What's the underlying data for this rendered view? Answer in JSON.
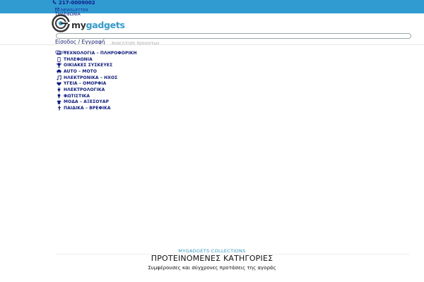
{
  "header": {
    "phone": "217-0009002",
    "newsletter_label": "NEWSLETTER",
    "phone_menu_label": "ΤΗΛΕΦΩΝΙΑ",
    "logo_text_prefix": "my",
    "logo_text_suffix": "gadgets"
  },
  "search": {
    "placeholder": "Αναζήτηση προϊόντων"
  },
  "account": {
    "login_label": "Είσοδος / Εγγραφή"
  },
  "menu": {
    "trigger_label": "Close"
  },
  "categories": [
    {
      "label": "ΤΕΧΝΟΛΟΓΙΑ – ΠΛΗΡΟΦΟΡΙΚΗ",
      "icon": "laptop-icon"
    },
    {
      "label": "ΤΗΛΕΦΩΝΙΑ",
      "icon": ""
    },
    {
      "label": "ΟΙΚΙΑΚΕΣ ΣΥΣΚΕΥΕΣ",
      "icon": "trophy-icon"
    },
    {
      "label": "AUTO – MOTO",
      "icon": "car-icon"
    },
    {
      "label": "ΗΛΕΚΤΡΟΝΙΚΑ – ΗΧΟΣ",
      "icon": "music-note-icon"
    },
    {
      "label": "ΥΓΕΙΑ – ΟΜΟΡΦΙΑ",
      "icon": "heart-icon"
    },
    {
      "label": "ΗΛΕΚΤΡΟΛΟΓΙΚΑ",
      "icon": "plug-icon"
    },
    {
      "label": "ΦΩΤΙΣΤΙΚΑ",
      "icon": "lightbulb-icon"
    },
    {
      "label": "ΜΟΔΑ – ΑΞΕΣΟΥΑΡ",
      "icon": "tshirt-icon"
    },
    {
      "label": "ΠΑΙΔΙΚΑ – ΒΡΕΦΙΚΑ",
      "icon": "child-icon"
    }
  ],
  "featured": {
    "eyebrow": "MYGADGETS COLLECTIONS",
    "title": "ΠΡΟΤΕΙΝΟΜΕΝΕΣ ΚΑΤΗΓΟΡΙΕΣ",
    "subtitle": "Συμφέρουσες και σύγχρονες προτάσεις της αγοράς"
  },
  "colors": {
    "topbar": "#2f9bd0",
    "nav_text": "#0d1b8a",
    "accent": "#2f9bd0"
  }
}
